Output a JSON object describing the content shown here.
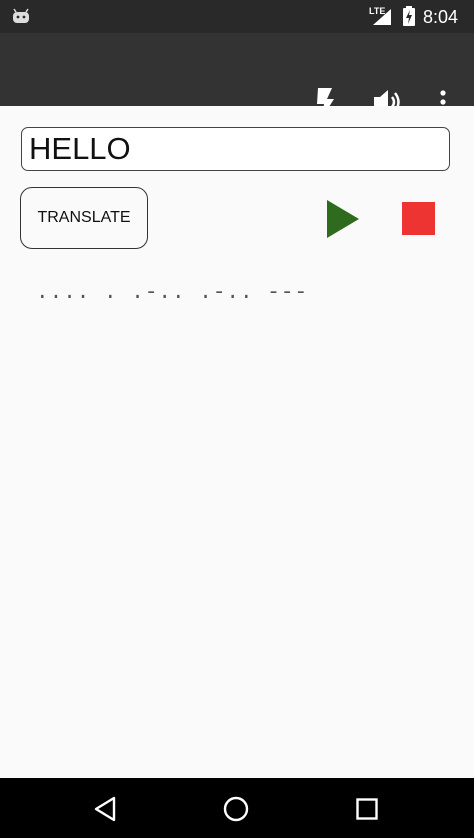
{
  "status_bar": {
    "time": "8:04",
    "network_label": "LTE",
    "icons": [
      "android-icon",
      "signal-icon",
      "battery-charging-icon"
    ]
  },
  "app_bar": {
    "actions": [
      "flash-icon",
      "volume-icon",
      "overflow-menu-icon"
    ]
  },
  "main": {
    "input_value": "HELLO",
    "translate_label": "TRANSLATE",
    "morse_output": ".... . .-.. .-.. ---",
    "play_color": "#2e6b1e",
    "stop_color": "#ee3333"
  },
  "nav_bar": {
    "buttons": [
      "back-icon",
      "home-icon",
      "recents-icon"
    ]
  }
}
